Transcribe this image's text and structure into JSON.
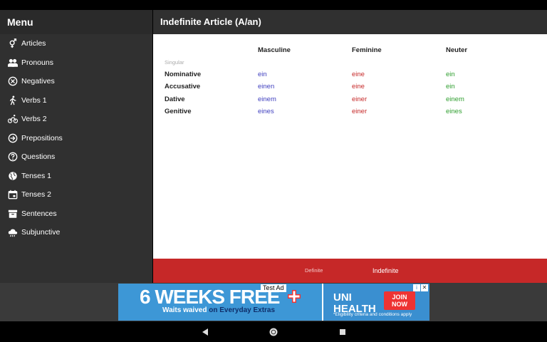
{
  "sidebar": {
    "title": "Menu",
    "items": [
      {
        "label": "Articles",
        "icon": "gender-icon"
      },
      {
        "label": "Pronouns",
        "icon": "people-icon"
      },
      {
        "label": "Negatives",
        "icon": "cancel-circle-icon"
      },
      {
        "label": "Verbs 1",
        "icon": "walk-icon"
      },
      {
        "label": "Verbs 2",
        "icon": "bike-icon"
      },
      {
        "label": "Prepositions",
        "icon": "arrow-circle-icon"
      },
      {
        "label": "Questions",
        "icon": "help-circle-icon"
      },
      {
        "label": "Tenses 1",
        "icon": "globe-icon"
      },
      {
        "label": "Tenses 2",
        "icon": "calendar-icon"
      },
      {
        "label": "Sentences",
        "icon": "archive-icon"
      },
      {
        "label": "Subjunctive",
        "icon": "weather-cloud-icon"
      }
    ]
  },
  "header": {
    "title": "Indefinite Article (A/an)"
  },
  "table": {
    "columns": [
      "Masculine",
      "Feminine",
      "Neuter"
    ],
    "section": "Singular",
    "rows": [
      {
        "label": "Nominative",
        "masc": "ein",
        "fem": "eine",
        "neut": "ein"
      },
      {
        "label": "Accusative",
        "masc": "einen",
        "fem": "eine",
        "neut": "ein"
      },
      {
        "label": "Dative",
        "masc": "einem",
        "fem": "einer",
        "neut": "einem"
      },
      {
        "label": "Genitive",
        "masc": "eines",
        "fem": "einer",
        "neut": "eines"
      }
    ]
  },
  "tabs": {
    "definite": "Definite",
    "indefinite": "Indefinite",
    "active": "Indefinite"
  },
  "ad": {
    "test_label": "Test Ad",
    "headline": "6 WEEKS FREE",
    "sub_lead": "Waits waived",
    "sub_accent": "on Everyday Extras",
    "brand": "UNI HEALTH",
    "cta": "JOIN NOW",
    "fine": "*Eligibility criteria and conditions apply",
    "close": "✕",
    "info": "i"
  },
  "colors": {
    "masculine": "#3f3fbf",
    "feminine": "#c62828",
    "neuter": "#2e9e2e",
    "accent": "#c62828"
  }
}
